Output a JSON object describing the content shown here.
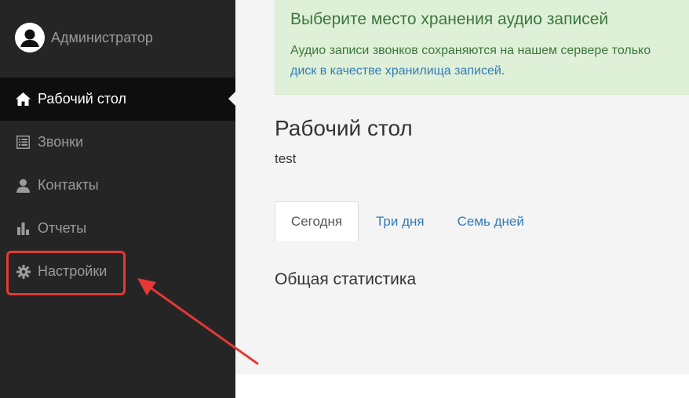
{
  "user": {
    "name": "Администратор"
  },
  "nav": {
    "items": [
      {
        "label": "Рабочий стол",
        "icon": "home-icon",
        "active": true
      },
      {
        "label": "Звонки",
        "icon": "list-icon",
        "active": false
      },
      {
        "label": "Контакты",
        "icon": "user-icon",
        "active": false
      },
      {
        "label": "Отчеты",
        "icon": "bar-chart-icon",
        "active": false
      },
      {
        "label": "Настройки",
        "icon": "gear-icon",
        "active": false
      }
    ]
  },
  "alert": {
    "title": "Выберите место хранения аудио записей",
    "text": "Аудио записи звонков сохраняются на нашем сервере только",
    "link_text": "диск в качестве хранилища записей",
    "text_end": "."
  },
  "page": {
    "title": "Рабочий стол",
    "subtitle": "test"
  },
  "tabs": [
    {
      "label": "Сегодня",
      "active": true
    },
    {
      "label": "Три дня",
      "active": false
    },
    {
      "label": "Семь дней",
      "active": false
    }
  ],
  "section": {
    "title": "Общая статистика"
  },
  "colors": {
    "sidebar_bg": "#252525",
    "sidebar_active_bg": "#0e0e0e",
    "alert_bg": "#dff0d8",
    "alert_text": "#3c763d",
    "link": "#337ab7",
    "annotation": "#e53935"
  }
}
